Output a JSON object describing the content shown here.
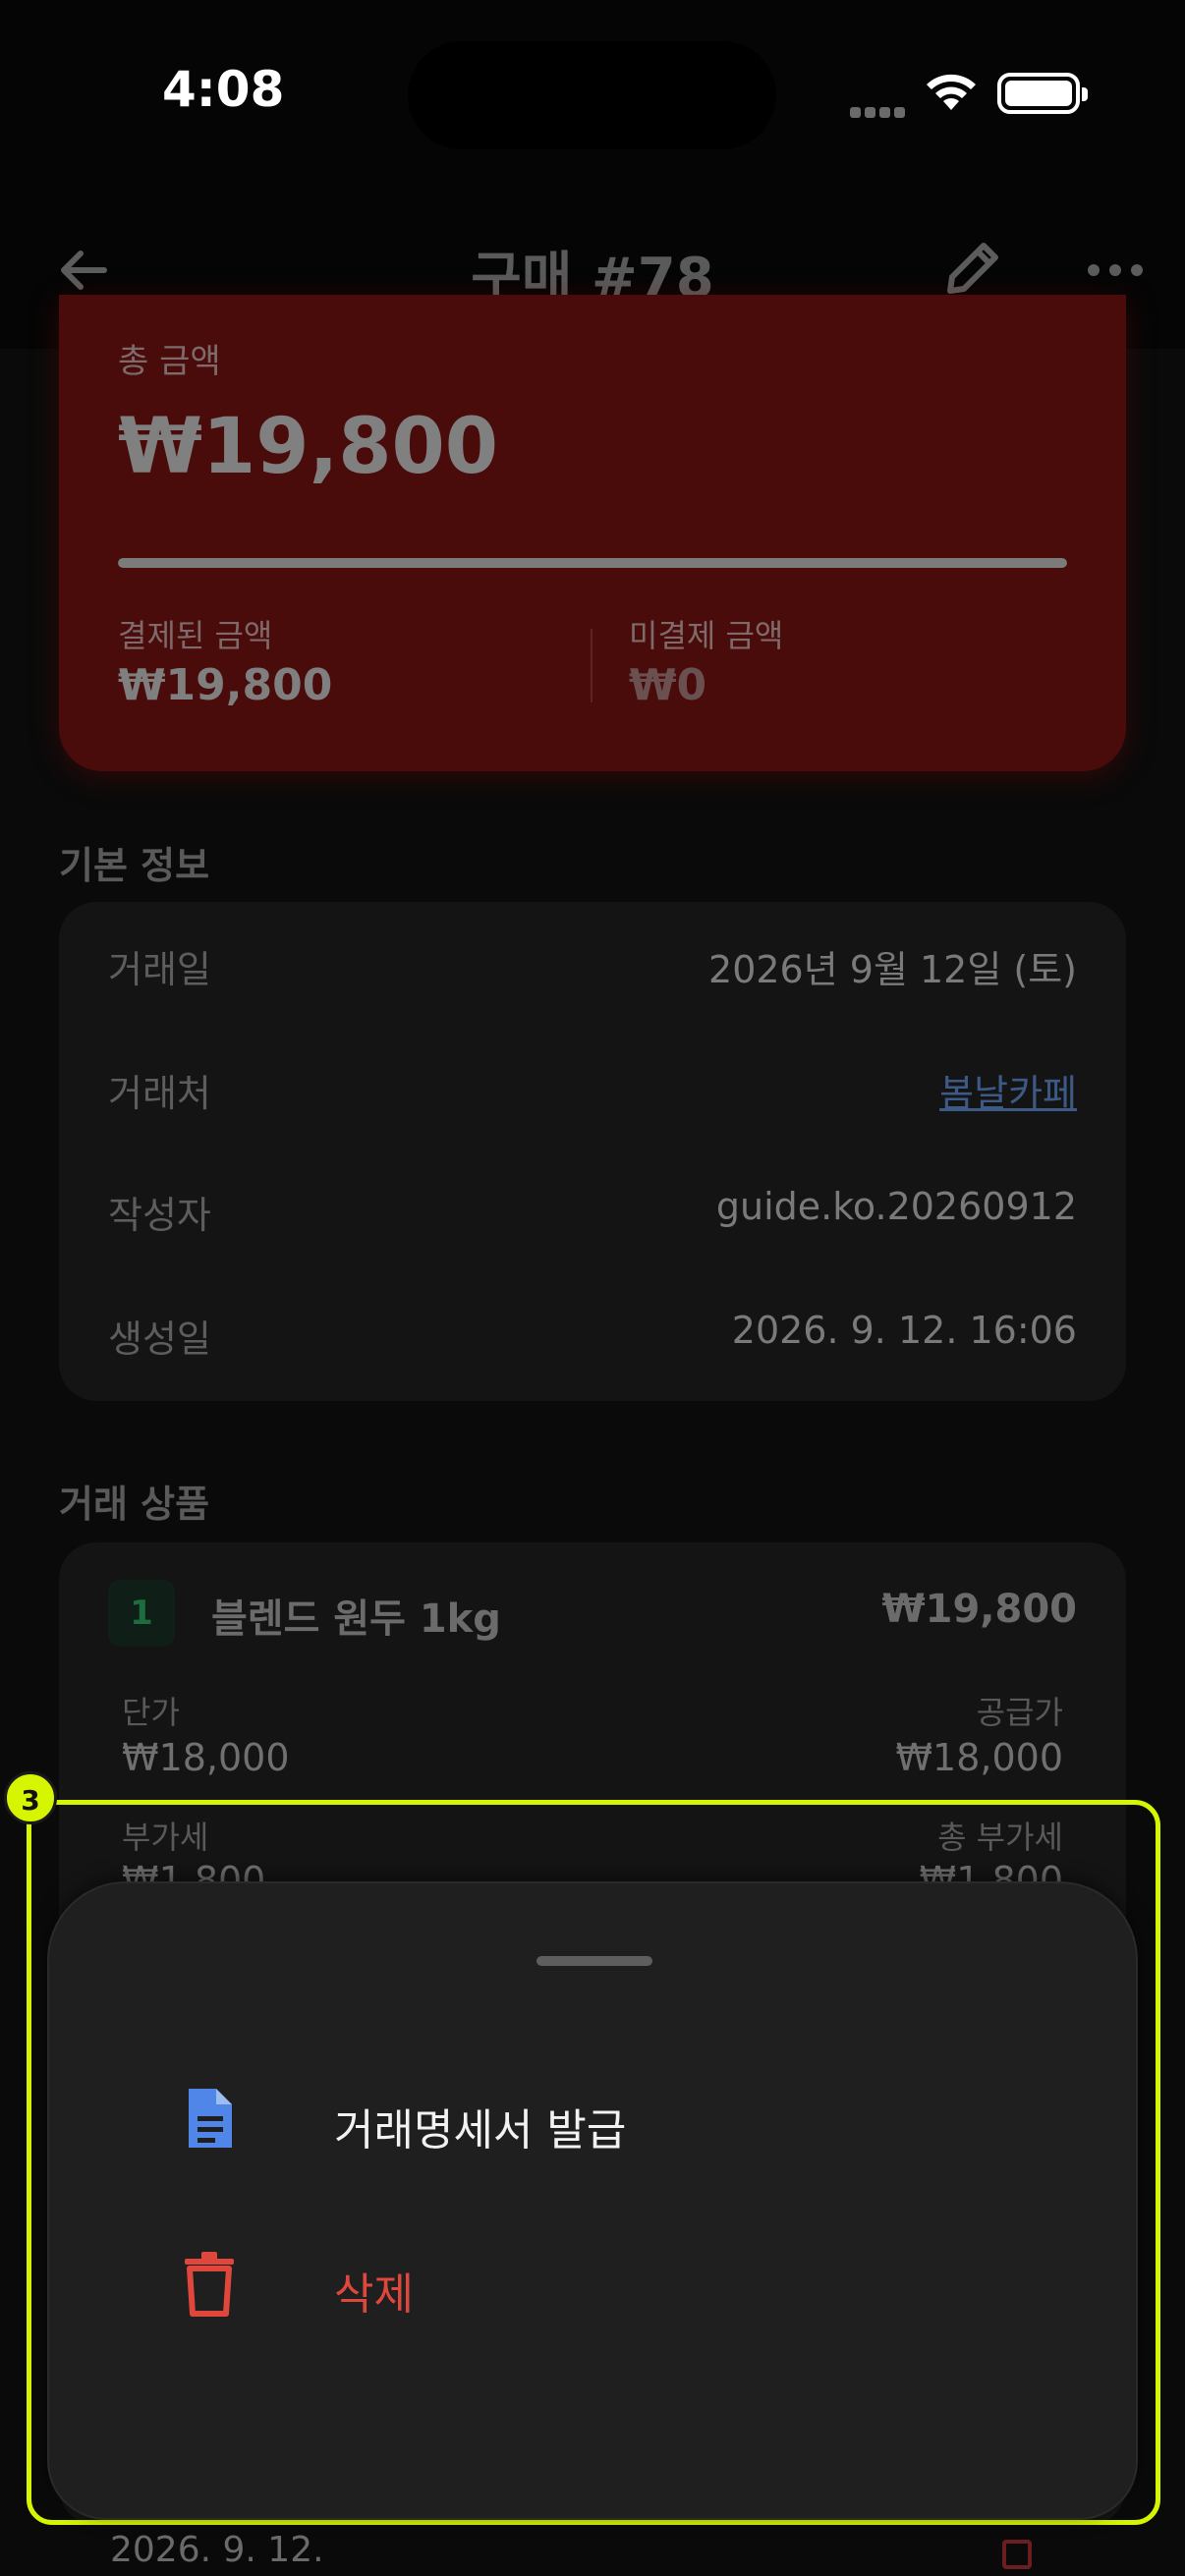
{
  "status_bar": {
    "time": "4:08"
  },
  "header": {
    "title": "구매 #78"
  },
  "summary": {
    "total_label": "총 금액",
    "total_value": "₩19,800",
    "paid_fraction": 1.0,
    "paid_label": "결제된 금액",
    "paid_value": "₩19,800",
    "unpaid_label": "미결제 금액",
    "unpaid_value": "₩0"
  },
  "basic_info": {
    "section_title": "기본 정보",
    "rows": [
      {
        "label": "거래일",
        "value": "2026년 9월 12일 (토)"
      },
      {
        "label": "거래처",
        "value": "봄날카페"
      },
      {
        "label": "작성자",
        "value": "guide.ko.20260912"
      },
      {
        "label": "생성일",
        "value": "2026. 9. 12. 16:06"
      }
    ]
  },
  "items": {
    "section_title": "거래 상품",
    "list": [
      {
        "index": "1",
        "name": "블렌드 원두 1kg",
        "price": "₩19,800",
        "unit_price_label": "단가",
        "unit_price": "₩18,000",
        "supply_label": "공급가",
        "supply_value": "₩18,000",
        "vat_label": "부가세",
        "vat_value": "₩1,800",
        "total_vat_label": "총 부가세",
        "total_vat_value": "₩1,800"
      }
    ],
    "bottom_date": "2026. 9. 12."
  },
  "annotation": {
    "badge": "3",
    "color": "#d6f500"
  },
  "sheet": {
    "actions": [
      {
        "label": "거래명세서 발급",
        "icon": "document-icon",
        "color": "#4f86e8"
      },
      {
        "label": "삭제",
        "icon": "trash-icon",
        "color": "#e0473c"
      }
    ]
  }
}
